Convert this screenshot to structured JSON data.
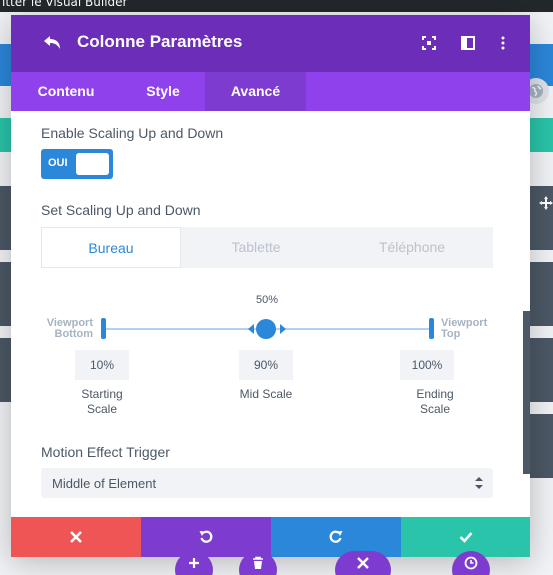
{
  "background": {
    "topbar_text": "itter le Visual Builder"
  },
  "modal": {
    "title": "Colonne Paramètres",
    "tabs": [
      {
        "label": "Contenu",
        "active": false
      },
      {
        "label": "Style",
        "active": false
      },
      {
        "label": "Avancé",
        "active": true
      }
    ],
    "scaling_toggle": {
      "label": "Enable Scaling Up and Down",
      "state_text": "OUI"
    },
    "set_scaling": {
      "label": "Set Scaling Up and Down",
      "devices": [
        {
          "label": "Bureau",
          "active": true
        },
        {
          "label": "Tablette",
          "active": false
        },
        {
          "label": "Téléphone",
          "active": false
        }
      ],
      "mid_position_label": "50%",
      "viewport_bottom": [
        "Viewport",
        "Bottom"
      ],
      "viewport_top": [
        "Viewport",
        "Top"
      ],
      "starting_scale": {
        "value": "10%",
        "label_line1": "Starting",
        "label_line2": "Scale"
      },
      "mid_scale": {
        "value": "90%",
        "label": "Mid Scale"
      },
      "ending_scale": {
        "value": "100%",
        "label_line1": "Ending",
        "label_line2": "Scale"
      }
    },
    "motion_trigger": {
      "label": "Motion Effect Trigger",
      "selected": "Middle of Element"
    }
  },
  "colors": {
    "header": "#6c2eb9",
    "tabs": "#8f42ec",
    "accent": "#2b87da",
    "cancel": "#ef5555",
    "undo": "#7e3bd0",
    "redo": "#2b87da",
    "save": "#29c4a9"
  }
}
